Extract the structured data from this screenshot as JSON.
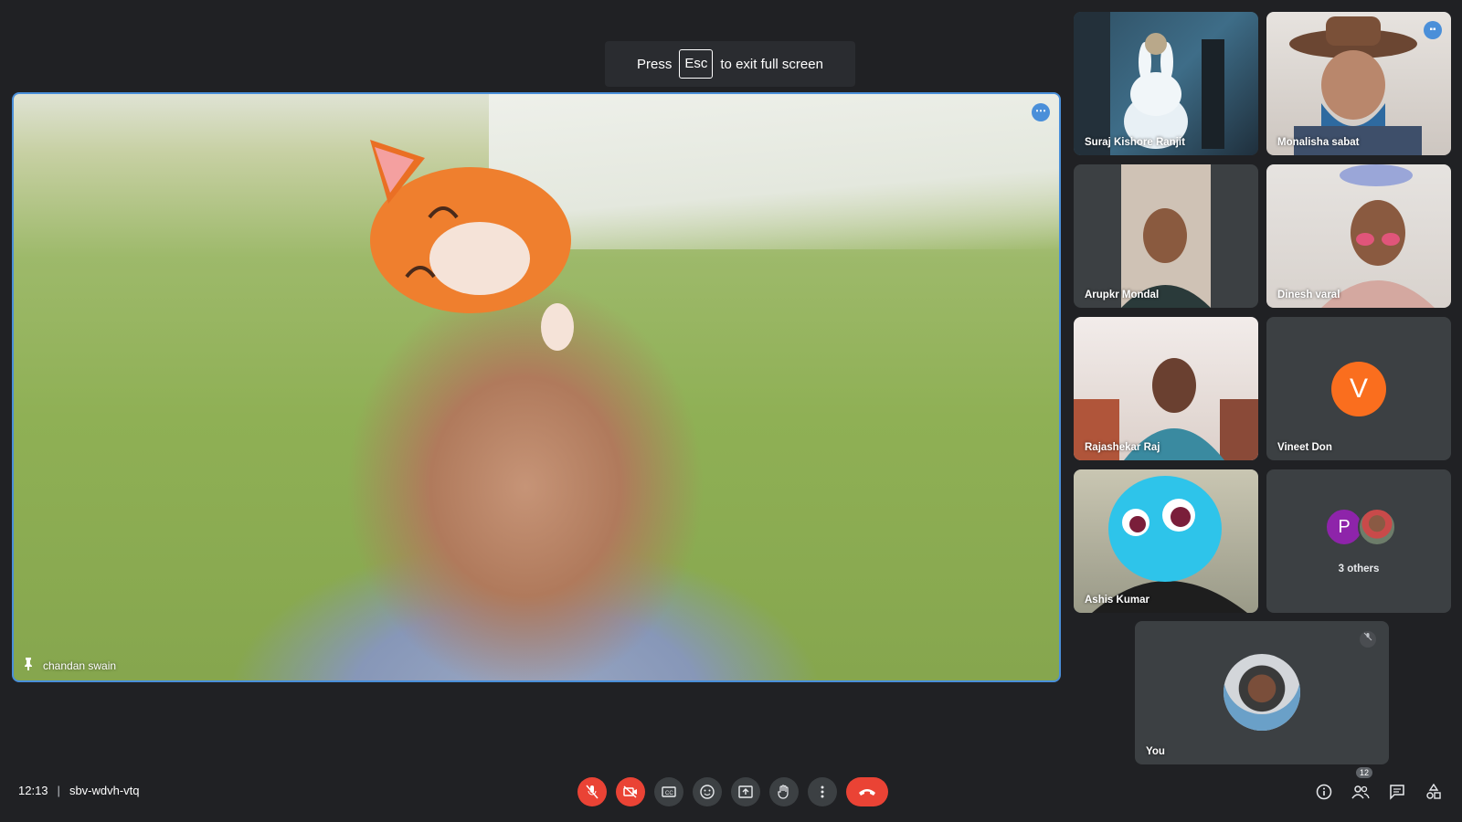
{
  "fullscreen_banner": {
    "press": "Press",
    "key": "Esc",
    "suffix": "to exit full screen"
  },
  "main_tile": {
    "participant_name": "chandan swain"
  },
  "tiles": [
    {
      "name": "Suraj Kishore Ranjit"
    },
    {
      "name": "Monalisha sabat"
    },
    {
      "name": "Arupkr Mondal"
    },
    {
      "name": "Dinesh varal"
    },
    {
      "name": "Rajashekar Raj"
    },
    {
      "name": "Vineet Don",
      "avatar_letter": "V"
    },
    {
      "name": "Ashis Kumar"
    },
    {
      "others_label": "3 others",
      "avatar_letter": "P"
    }
  ],
  "self_tile": {
    "name": "You"
  },
  "meeting": {
    "time": "12:13",
    "separator": "|",
    "code": "sbv-wdvh-vtq"
  },
  "participants_count": "12",
  "colors": {
    "background": "#202124",
    "tile": "#3c4043",
    "accent": "#4a8fd9",
    "danger": "#ea4335"
  }
}
